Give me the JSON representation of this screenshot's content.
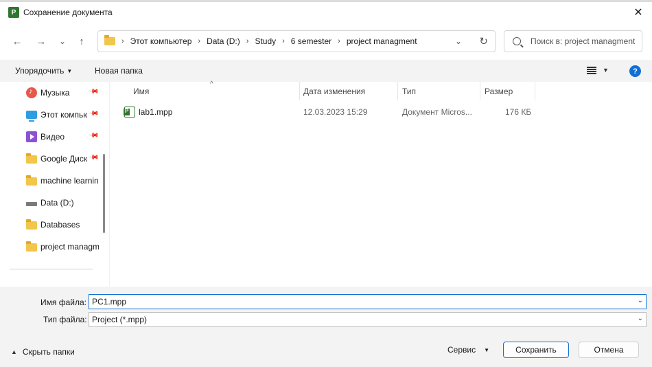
{
  "window": {
    "title": "Сохранение документа",
    "app_icon_letter": "P",
    "close_glyph": "✕"
  },
  "nav": {
    "back_glyph": "←",
    "forward_glyph": "→",
    "recent_glyph": "⌄",
    "up_glyph": "↑",
    "breadcrumb": [
      "Этот компьютер",
      "Data (D:)",
      "Study",
      "6 semester",
      "project managment"
    ],
    "sep_glyph": "›",
    "dropdown_glyph": "⌄",
    "refresh_glyph": "↻",
    "search_placeholder": "Поиск в: project managment"
  },
  "toolbar": {
    "organize_label": "Упорядочить",
    "new_folder_label": "Новая папка",
    "caret_glyph": "▼",
    "help_glyph": "?"
  },
  "sidebar": {
    "items": [
      {
        "label": "Музыка",
        "icon": "music-icon",
        "pinned": true
      },
      {
        "label": "Этот компьютер",
        "icon": "computer-icon",
        "pinned": true
      },
      {
        "label": "Видео",
        "icon": "video-icon",
        "pinned": true
      },
      {
        "label": "Google Диск",
        "icon": "folder-icon",
        "pinned": true
      },
      {
        "label": "machine learning",
        "icon": "folder-icon",
        "pinned": false
      },
      {
        "label": "Data (D:)",
        "icon": "drive-icon",
        "pinned": false
      },
      {
        "label": "Databases",
        "icon": "folder-icon",
        "pinned": false
      },
      {
        "label": "project managment",
        "icon": "folder-icon",
        "pinned": false
      }
    ],
    "pin_glyph": "📌"
  },
  "columns": {
    "name": "Имя",
    "modified": "Дата изменения",
    "type": "Тип",
    "size": "Размер",
    "sort_glyph": "^"
  },
  "files": [
    {
      "name": "lab1.mpp",
      "modified": "12.03.2023 15:29",
      "type": "Документ Micros...",
      "size": "176 КБ",
      "icon": "mpp-file-icon"
    }
  ],
  "form": {
    "filename_label": "Имя файла:",
    "filename_value": "PC1.mpp",
    "filetype_label": "Тип файла:",
    "filetype_value": "Project (*.mpp)",
    "caret_glyph": "⌄"
  },
  "footer": {
    "hide_folders_label": "Скрыть папки",
    "hide_caret_glyph": "▲",
    "service_label": "Сервис",
    "service_caret_glyph": "▼",
    "save_label": "Сохранить",
    "cancel_label": "Отмена"
  },
  "colors": {
    "accent": "#1070d3",
    "project_green": "#31752f",
    "folder_yellow": "#f2c54b"
  }
}
